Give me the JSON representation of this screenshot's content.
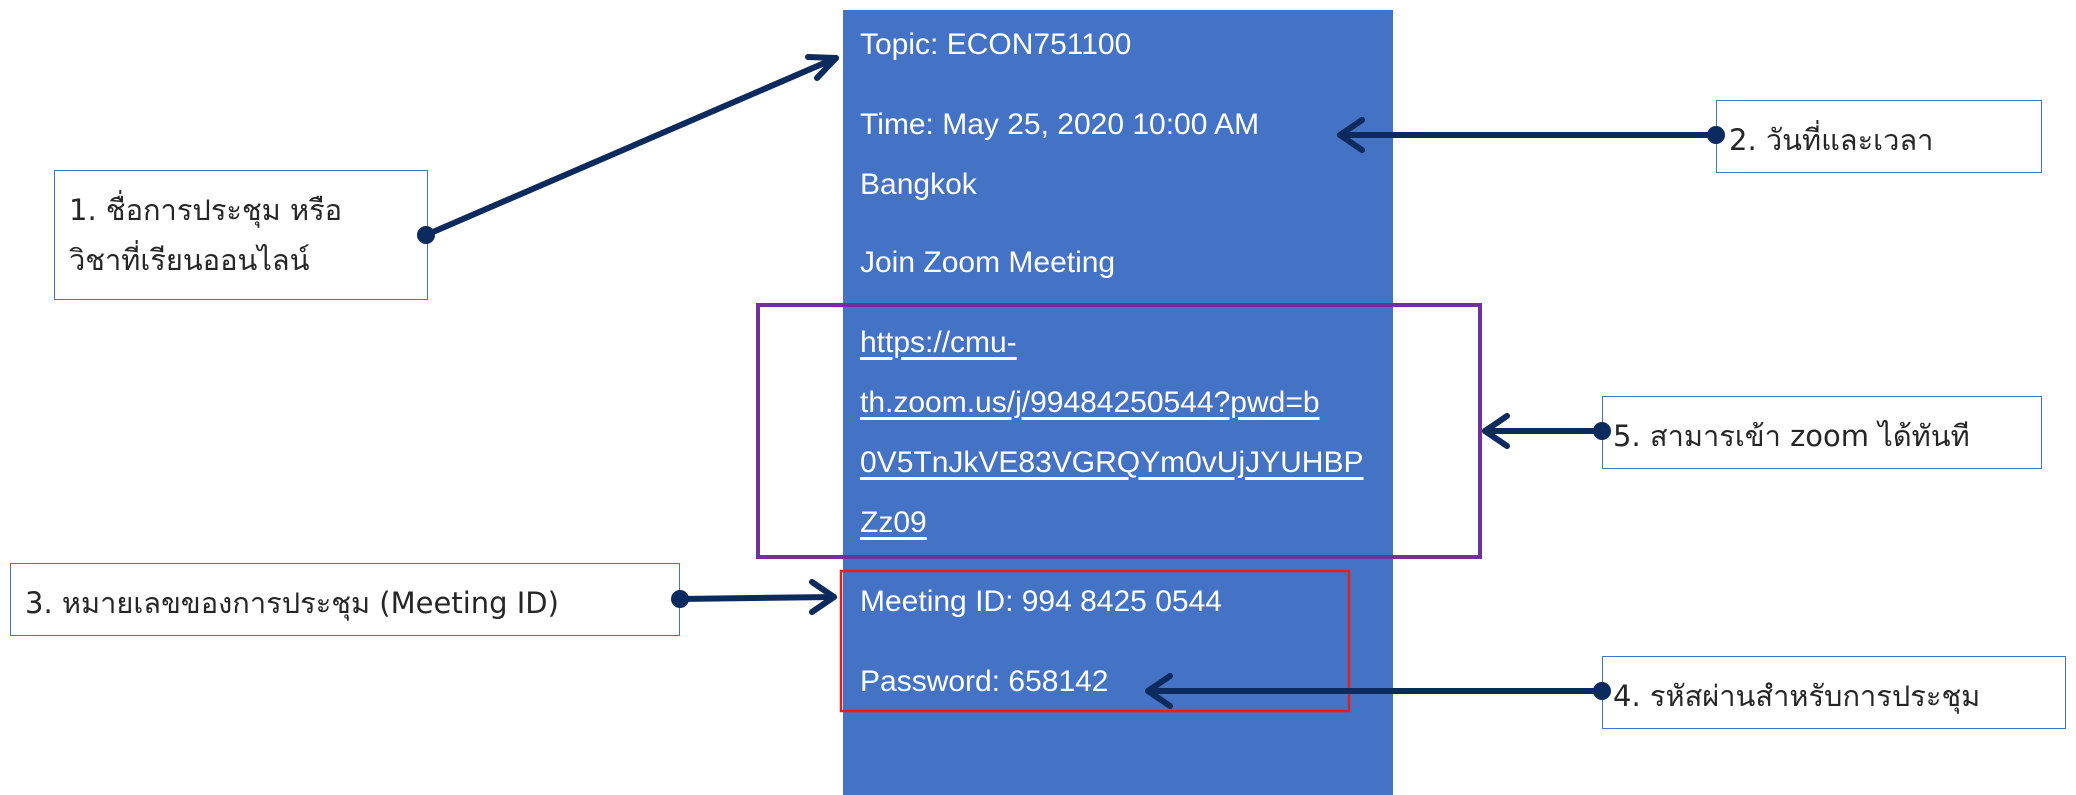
{
  "meeting": {
    "topic": "Topic: ECON751100",
    "time_line1": "Time: May 25, 2020 10:00 AM",
    "time_line2": "Bangkok",
    "join": "Join Zoom Meeting",
    "link_lines": [
      "https://cmu-",
      "th.zoom.us/j/99484250544?pwd=b",
      "0V5TnJkVE83VGRQYm0vUjJYUHBP",
      "Zz09"
    ],
    "meeting_id": "Meeting ID: 994 8425 0544",
    "password": "Password: 658142"
  },
  "callouts": {
    "c1": [
      "1. ชื่อการประชุม หรือ",
      "วิชาที่เรียนออนไลน์"
    ],
    "c2": "2. วันที่และเวลา",
    "c3": "3. หมายเลขของการประชุม (Meeting ID)",
    "c4": "4. รหัสผ่านสำหรับการประชุม",
    "c5": "5. สามารเข้า zoom ได้ทันที"
  },
  "colors": {
    "panel": "#4472c4",
    "arrow": "#0b2a5e",
    "link_box": "#7030a0",
    "credentials_box": "#e02020",
    "callout_border": "#4472c4"
  }
}
